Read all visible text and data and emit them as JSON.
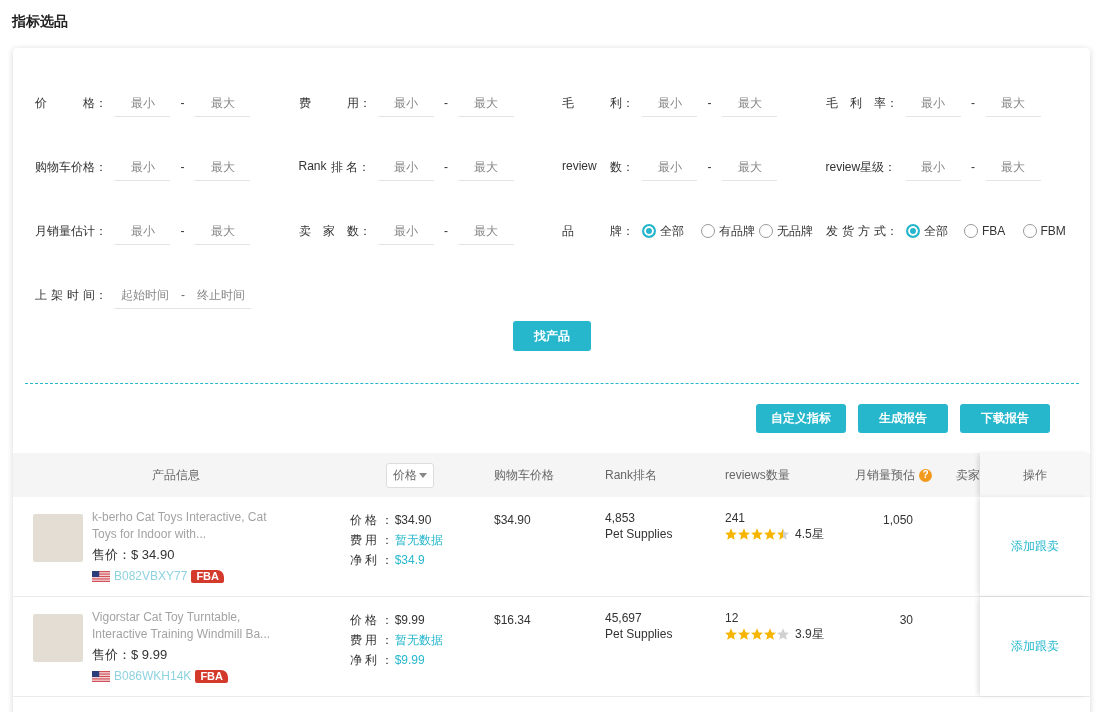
{
  "page_title": "指标选品",
  "filters": [
    {
      "kind": "range",
      "label": "价 格：",
      "min_placeholder": "最小",
      "separator": "-",
      "max_placeholder": "最大"
    },
    {
      "kind": "range",
      "label": "费 用：",
      "min_placeholder": "最小",
      "separator": "-",
      "max_placeholder": "最大"
    },
    {
      "kind": "range",
      "label": "毛 利：",
      "min_placeholder": "最小",
      "separator": "-",
      "max_placeholder": "最大"
    },
    {
      "kind": "range",
      "label": "毛 利 率：",
      "min_placeholder": "最小",
      "separator": "-",
      "max_placeholder": "最大"
    },
    {
      "kind": "range",
      "label": "购物车价格：",
      "min_placeholder": "最小",
      "separator": "-",
      "max_placeholder": "最大"
    },
    {
      "kind": "range",
      "label": "Rank 排 名：",
      "min_placeholder": "最小",
      "separator": "-",
      "max_placeholder": "最大"
    },
    {
      "kind": "range",
      "label": "review 数：",
      "min_placeholder": "最小",
      "separator": "-",
      "max_placeholder": "最大"
    },
    {
      "kind": "range",
      "label": "review星级：",
      "min_placeholder": "最小",
      "separator": "-",
      "max_placeholder": "最大"
    },
    {
      "kind": "range",
      "label": "月销量估计：",
      "min_placeholder": "最小",
      "separator": "-",
      "max_placeholder": "最大"
    },
    {
      "kind": "range",
      "label": "卖 家 数：",
      "min_placeholder": "最小",
      "separator": "-",
      "max_placeholder": "最大"
    },
    {
      "kind": "radio",
      "label": "品 牌：",
      "options": [
        {
          "label": "全部",
          "selected": true
        },
        {
          "label": "有品牌",
          "selected": false
        },
        {
          "label": "无品牌",
          "selected": false
        }
      ]
    },
    {
      "kind": "radio",
      "label": "发 货 方 式：",
      "options": [
        {
          "label": "全部",
          "selected": true
        },
        {
          "label": "FBA",
          "selected": false
        },
        {
          "label": "FBM",
          "selected": false
        }
      ]
    },
    {
      "kind": "date_range",
      "label": "上 架 时 间：",
      "start_placeholder": "起始时间",
      "separator": "-",
      "end_placeholder": "终止时间"
    }
  ],
  "search_button": "找产品",
  "report_buttons": [
    "自定义指标",
    "生成报告",
    "下载报告"
  ],
  "table": {
    "columns": [
      {
        "label": "产品信息",
        "kind": "plain"
      },
      {
        "label": "价格",
        "kind": "sort"
      },
      {
        "label": "购物车价格",
        "kind": "plain"
      },
      {
        "label": "Rank排名",
        "kind": "plain"
      },
      {
        "label": "reviews数量",
        "kind": "plain"
      },
      {
        "label": "月销量预估",
        "kind": "help",
        "help_icon": "?"
      },
      {
        "label": "卖家",
        "kind": "plain"
      },
      {
        "label": "操作",
        "kind": "pinned"
      }
    ],
    "rows": [
      {
        "title": "k-berho Cat Toys Interactive, Cat Toys for Indoor with...",
        "sale_price": "售价：$ 34.90",
        "asin": "B082VBXY77",
        "badge": "FBA",
        "price_details": [
          {
            "label": "价 格 ：",
            "value": "$34.90",
            "accent": false
          },
          {
            "label": "费 用 ：",
            "value": "暂无数据",
            "accent": true
          },
          {
            "label": "净 利 ：",
            "value": "$34.9",
            "accent": true
          }
        ],
        "cart_price": "$34.90",
        "rank": "4,853",
        "category": "Pet Supplies",
        "reviews": "241",
        "stars": 4.5,
        "rating": "4.5星",
        "monthly_sales": "1,050",
        "action": "添加跟卖"
      },
      {
        "title": "Vigorstar Cat Toy Turntable, Interactive Training Windmill Ba...",
        "sale_price": "售价：$ 9.99",
        "asin": "B086WKH14K",
        "badge": "FBA",
        "price_details": [
          {
            "label": "价 格 ：",
            "value": "$9.99",
            "accent": false
          },
          {
            "label": "费 用 ：",
            "value": "暂无数据",
            "accent": true
          },
          {
            "label": "净 利 ：",
            "value": "$9.99",
            "accent": true
          }
        ],
        "cart_price": "$16.34",
        "rank": "45,697",
        "category": "Pet Supplies",
        "reviews": "12",
        "stars": 4,
        "rating": "3.9星",
        "monthly_sales": "30",
        "action": "添加跟卖"
      }
    ]
  }
}
